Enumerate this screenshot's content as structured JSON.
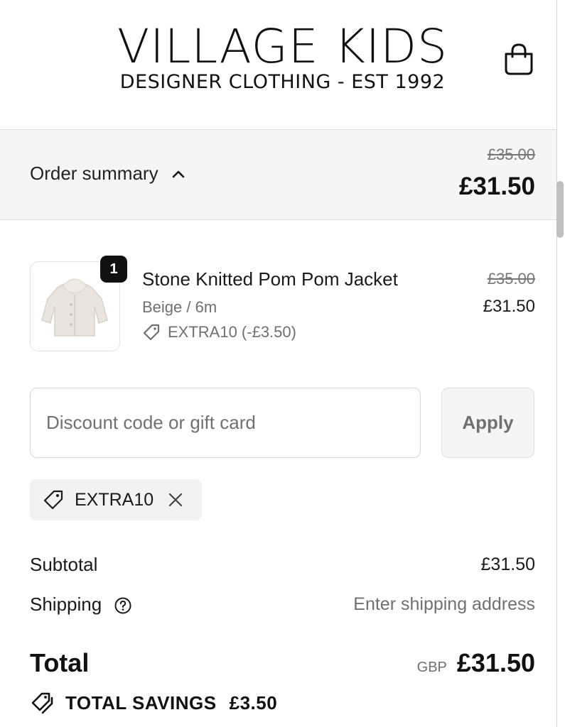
{
  "header": {
    "brand": "VILLAGE KIDS",
    "tagline": "DESIGNER CLOTHING - EST 1992",
    "cart_icon": "shopping-bag-icon"
  },
  "summary_bar": {
    "label": "Order summary",
    "original_total": "£35.00",
    "total": "£31.50"
  },
  "product": {
    "quantity": "1",
    "name": "Stone Knitted Pom Pom Jacket",
    "variant": "Beige / 6m",
    "discount": "EXTRA10 (-£3.50)",
    "original_price": "£35.00",
    "price": "£31.50"
  },
  "discount_form": {
    "placeholder": "Discount code or gift card",
    "apply_label": "Apply",
    "applied_code": "EXTRA10"
  },
  "totals": {
    "subtotal_label": "Subtotal",
    "subtotal_value": "£31.50",
    "shipping_label": "Shipping",
    "shipping_value": "Enter shipping address",
    "total_label": "Total",
    "currency": "GBP",
    "total_value": "£31.50",
    "savings_label": "TOTAL SAVINGS",
    "savings_value": "£3.50"
  }
}
